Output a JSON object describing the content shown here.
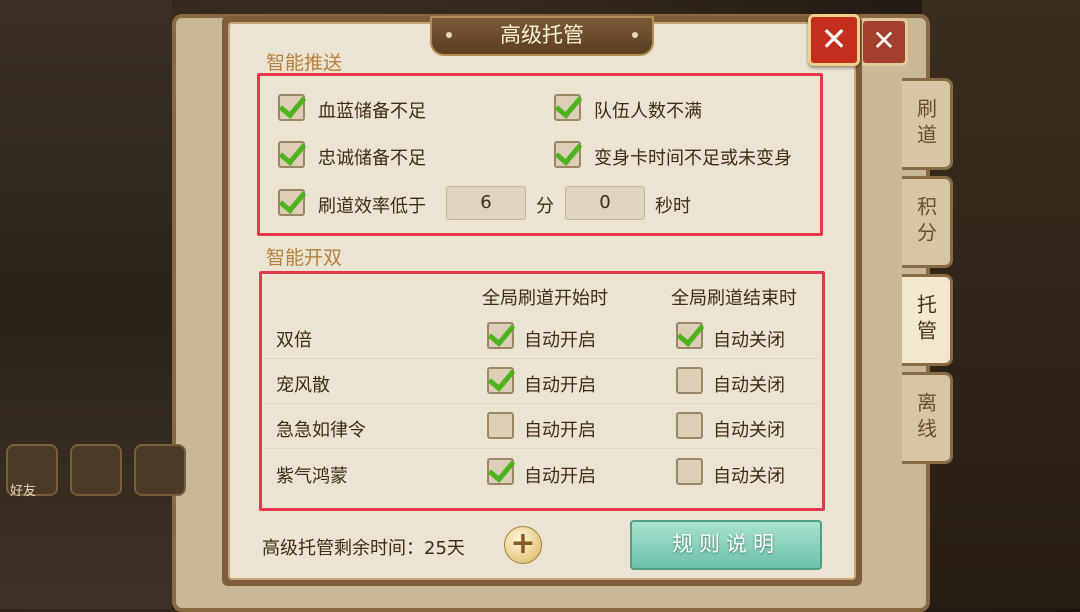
{
  "dialog": {
    "title": "高级托管",
    "close_icon": "close-icon"
  },
  "side_tabs": [
    "刷道",
    "积分",
    "托管",
    "离线"
  ],
  "side_tabs_active": "托管",
  "bottom_bar": {
    "friend_label": "好友"
  },
  "smart_push": {
    "section_title": "智能推送",
    "items": [
      {
        "label": "血蓝储备不足",
        "checked": true
      },
      {
        "label": "队伍人数不满",
        "checked": true
      },
      {
        "label": "忠诚储备不足",
        "checked": true
      },
      {
        "label": "变身卡时间不足或未变身",
        "checked": true
      },
      {
        "label": "刷道效率低于",
        "checked": true
      }
    ],
    "efficiency": {
      "minutes": "6",
      "minutes_unit": "分",
      "seconds": "0",
      "seconds_unit": "秒时"
    }
  },
  "smart_double": {
    "section_title": "智能开双",
    "col_start": "全局刷道开始时",
    "col_end": "全局刷道结束时",
    "rows": [
      {
        "name": "双倍",
        "start_label": "自动开启",
        "start_checked": true,
        "end_label": "自动关闭",
        "end_checked": true
      },
      {
        "name": "宠风散",
        "start_label": "自动开启",
        "start_checked": true,
        "end_label": "自动关闭",
        "end_checked": false
      },
      {
        "name": "急急如律令",
        "start_label": "自动开启",
        "start_checked": false,
        "end_label": "自动关闭",
        "end_checked": false
      },
      {
        "name": "紫气鸿蒙",
        "start_label": "自动开启",
        "start_checked": true,
        "end_label": "自动关闭",
        "end_checked": false
      }
    ]
  },
  "footer": {
    "remaining_text": "高级托管剩余时间：25天",
    "plus_icon": "plus-icon",
    "rules_button": "规则说明"
  },
  "colors": {
    "highlight_border": "#e5384a",
    "check_green": "#4fb31f",
    "section_title": "#b67f3c",
    "rules_button": "#6cc1aa"
  }
}
